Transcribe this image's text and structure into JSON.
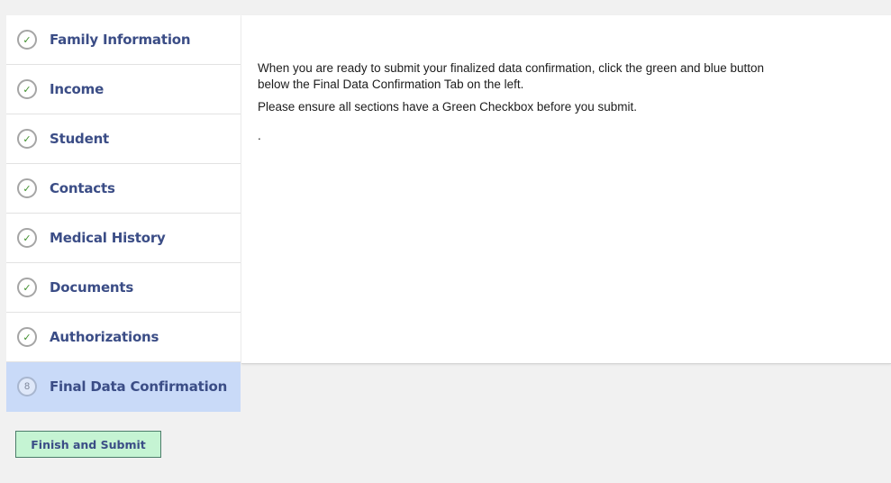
{
  "sidebar": {
    "steps": [
      {
        "label": "Family Information",
        "marker": "✓",
        "status": "complete"
      },
      {
        "label": "Income",
        "marker": "✓",
        "status": "complete"
      },
      {
        "label": "Student",
        "marker": "✓",
        "status": "complete"
      },
      {
        "label": "Contacts",
        "marker": "✓",
        "status": "complete"
      },
      {
        "label": "Medical History",
        "marker": "✓",
        "status": "complete"
      },
      {
        "label": "Documents",
        "marker": "✓",
        "status": "complete"
      },
      {
        "label": "Authorizations",
        "marker": "✓",
        "status": "complete"
      },
      {
        "label": "Final Data Confirmation",
        "marker": "8",
        "status": "active"
      }
    ]
  },
  "content": {
    "paragraph1": "When you are ready to submit your finalized data confirmation, click the green and blue button below the Final Data Confirmation Tab on the left.",
    "paragraph2": "Please ensure all sections have a Green Checkbox before you submit.",
    "paragraph3": "."
  },
  "actions": {
    "finish_label": "Finish and Submit"
  },
  "colors": {
    "accent_text": "#3b4d86",
    "check_green": "#3f8f2c",
    "active_step_bg": "#c9daf8",
    "finish_button_bg": "#c5f4d3"
  }
}
